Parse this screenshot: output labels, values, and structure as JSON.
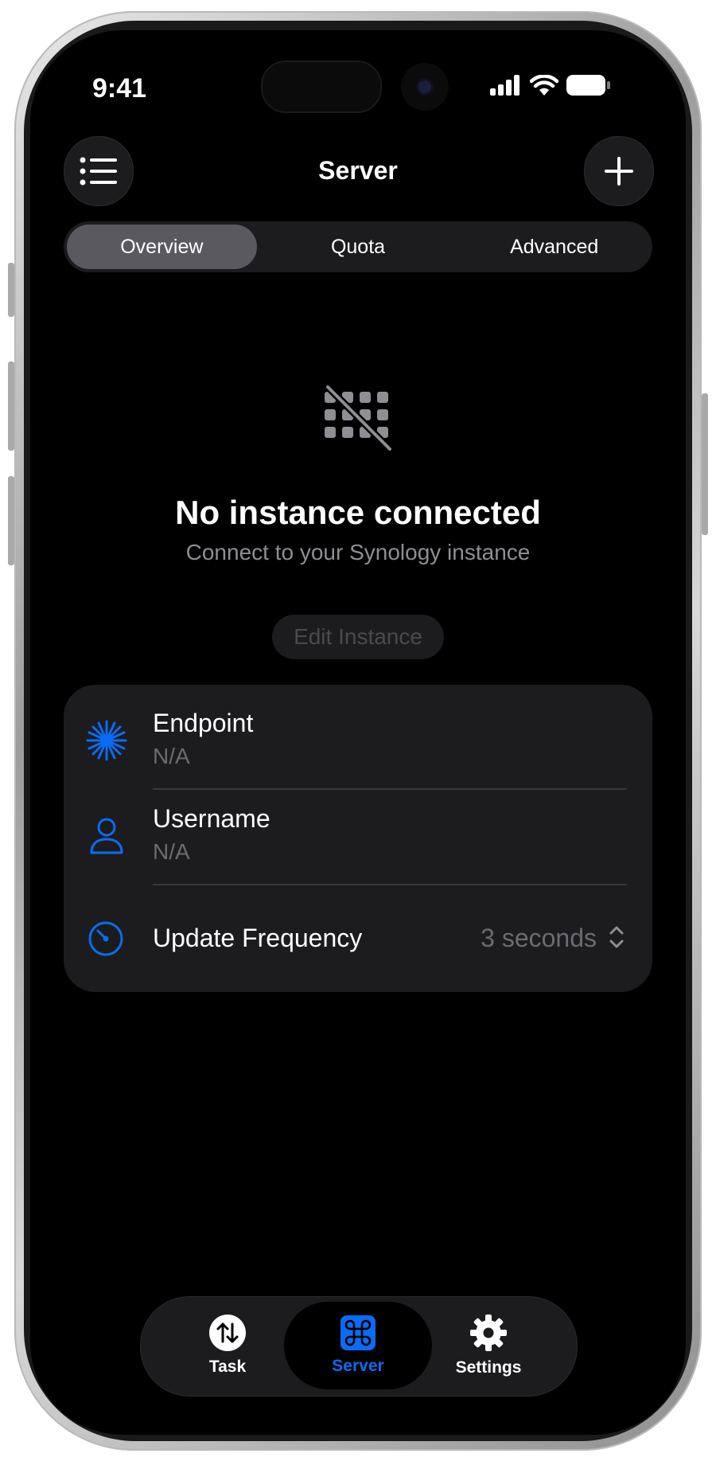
{
  "status_bar": {
    "time": "9:41"
  },
  "nav": {
    "title": "Server"
  },
  "segments": [
    "Overview",
    "Quota",
    "Advanced"
  ],
  "empty_state": {
    "title": "No instance connected",
    "subtitle": "Connect to your Synology instance",
    "button_label": "Edit Instance"
  },
  "settings": {
    "endpoint_label": "Endpoint",
    "endpoint_value": "N/A",
    "username_label": "Username",
    "username_value": "N/A",
    "frequency_label": "Update Frequency",
    "frequency_value": "3 seconds"
  },
  "tabs": [
    {
      "label": "Task",
      "icon": "arrows-up-down-icon"
    },
    {
      "label": "Server",
      "icon": "command-icon"
    },
    {
      "label": "Settings",
      "icon": "gear-icon"
    }
  ],
  "colors": {
    "accent": "#0a6cf5",
    "background": "#000000",
    "card": "#1c1c1e",
    "secondary_text": "#8e8e93"
  }
}
